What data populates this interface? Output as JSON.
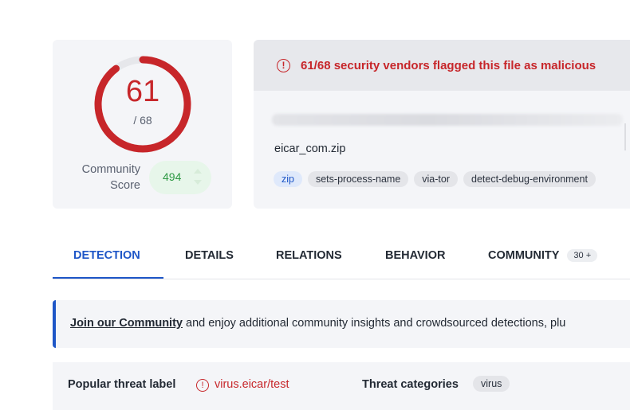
{
  "score": {
    "detected": 61,
    "total_label": "/ 68",
    "fraction": 0.897,
    "community_label_line1": "Community",
    "community_label_line2": "Score",
    "community_score": "494"
  },
  "banner": {
    "text": "61/68 security vendors flagged this file as malicious",
    "icon": "alert-circle-icon"
  },
  "file": {
    "name": "eicar_com.zip",
    "tags": [
      "zip",
      "sets-process-name",
      "via-tor",
      "detect-debug-environment"
    ]
  },
  "tabs": [
    {
      "label": "DETECTION",
      "active": true
    },
    {
      "label": "DETAILS",
      "active": false
    },
    {
      "label": "RELATIONS",
      "active": false
    },
    {
      "label": "BEHAVIOR",
      "active": false
    },
    {
      "label": "COMMUNITY",
      "active": false,
      "count": "30 +"
    }
  ],
  "community_banner": {
    "link": "Join our Community",
    "text": " and enjoy additional community insights and crowdsourced detections, plu"
  },
  "threat": {
    "popular_label": "Popular threat label",
    "popular_value": "virus.eicar/test",
    "categories_label": "Threat categories",
    "category": "virus"
  },
  "colors": {
    "malicious": "#c7262a",
    "accent": "#1e56c7",
    "positive": "#2f9a45"
  }
}
